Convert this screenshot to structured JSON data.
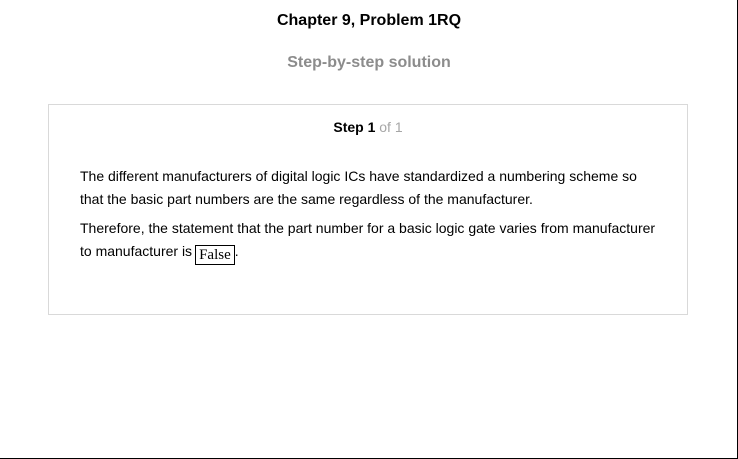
{
  "header": {
    "title": "Chapter 9, Problem 1RQ",
    "subtitle": "Step-by-step solution"
  },
  "step": {
    "label": "Step 1",
    "of_text": "of 1",
    "paragraph_1": "The different manufacturers of digital logic ICs have standardized a numbering scheme so that the basic part numbers are the same regardless of the manufacturer.",
    "paragraph_2_prefix": "Therefore, the statement that the part number for a basic logic gate varies from manufacturer to manufacturer is",
    "answer": "False",
    "paragraph_2_suffix": "."
  }
}
